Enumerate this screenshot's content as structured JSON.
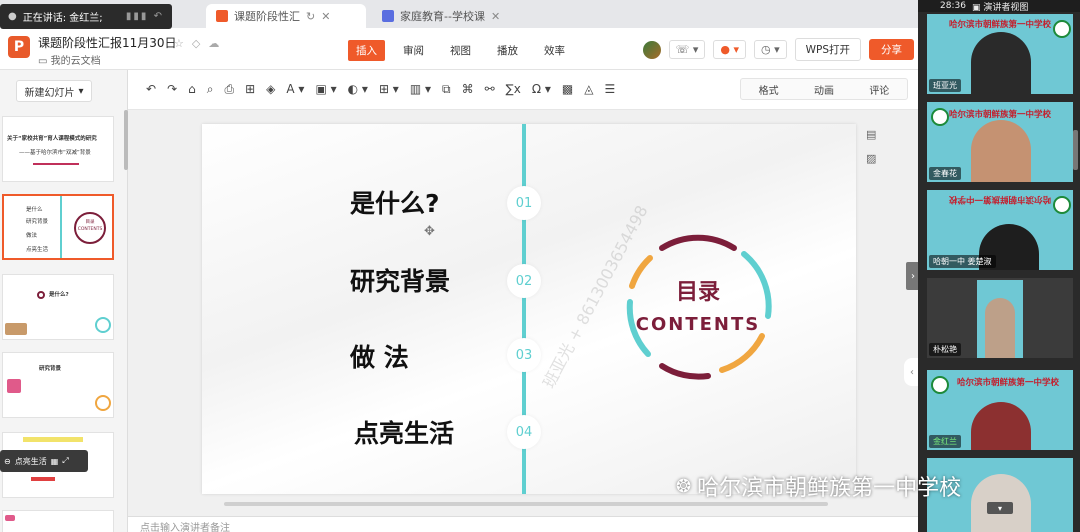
{
  "speaking": {
    "label": "正在讲话: 金红兰;"
  },
  "tabs": [
    {
      "label": "课题阶段性汇"
    },
    {
      "label": "家庭教育--学校课"
    }
  ],
  "doc": {
    "title": "课题阶段性汇报11月30日",
    "subtitle": "我的云文档"
  },
  "menu": {
    "insert": "插入",
    "review": "审阅",
    "view": "视图",
    "play": "播放",
    "efficiency": "效率"
  },
  "actions": {
    "wps_open": "WPS打开",
    "share": "分享"
  },
  "leftpanel": {
    "new_slide": "新建幻灯片",
    "thumb1_title": "关于“家校共育”育人课程模式的研究",
    "thumb1_sub": "——基于哈尔滨市“双减”背景",
    "thumb2_items": [
      "是什么",
      "研究背景",
      "做法",
      "点亮生活"
    ],
    "thumb2_right": "目录 CONTENTS",
    "thumb3_title": "是什么?",
    "thumb4_title": "研究背景",
    "mini_label": "点亮生活"
  },
  "toolbar": {
    "format": "格式",
    "animation": "动画",
    "comment": "评论"
  },
  "slide": {
    "items": [
      {
        "label": "是什么?",
        "num": "01"
      },
      {
        "label": "研究背景",
        "num": "02"
      },
      {
        "label": "做  法",
        "num": "03"
      },
      {
        "label": "点亮生活",
        "num": "04"
      }
    ],
    "ring_title": "目录",
    "ring_sub": "CONTENTS",
    "watermark": "班亚光 + 8613003654498"
  },
  "notes_placeholder": "点击输入演讲者备注",
  "video": {
    "time": "28:36",
    "mode": "演讲者视图",
    "school_banner": "哈尔滨市朝鲜族第一中学校",
    "participants": [
      "班亚光",
      "金春花",
      "哈朝一中 姜楚淑",
      "朴松艳",
      "金红兰"
    ]
  },
  "wechat_label": "哈尔滨市朝鲜族第一中学校",
  "colors": {
    "accent": "#ef5a2a",
    "teal": "#5fcfd0",
    "wine": "#7c1e3a",
    "gold": "#f0a640"
  }
}
